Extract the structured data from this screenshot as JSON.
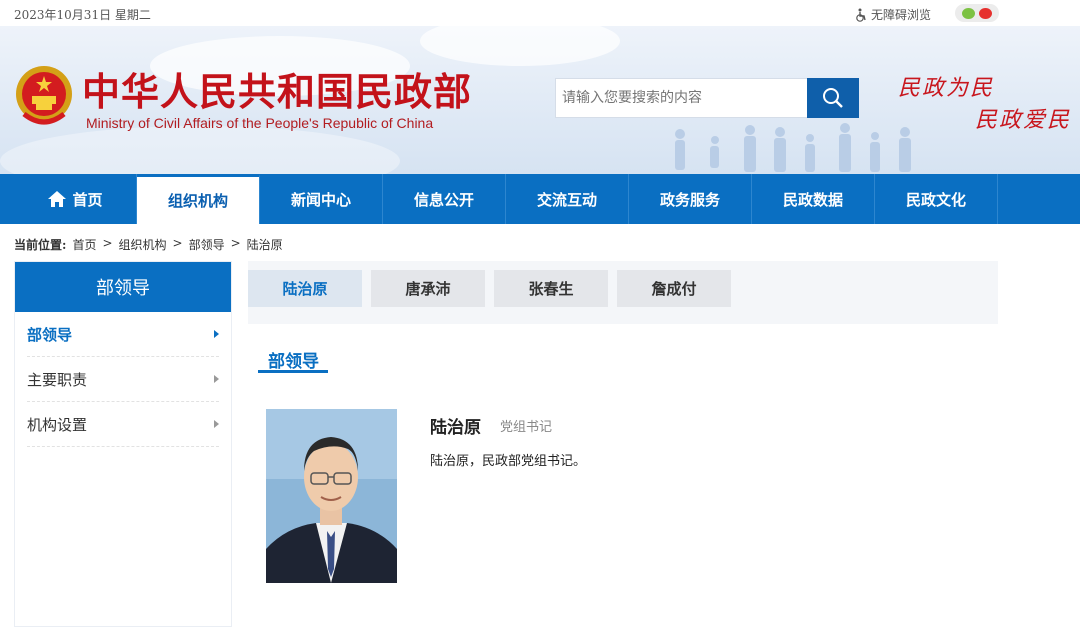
{
  "topbar": {
    "date": "2023年10月31日 星期二",
    "accessibility": "无障碍浏览"
  },
  "header": {
    "title": "中华人民共和国民政部",
    "subtitle": "Ministry of Civil Affairs of the People's Republic of China",
    "search_placeholder": "请输入您要搜索的内容",
    "slogan_1": "民政为民",
    "slogan_2": "民政爱民"
  },
  "nav": [
    "首页",
    "组织机构",
    "新闻中心",
    "信息公开",
    "交流互动",
    "政务服务",
    "民政数据",
    "民政文化"
  ],
  "breadcrumb": {
    "label": "当前位置:",
    "items": [
      "首页",
      ">",
      "组织机构",
      ">",
      "部领导",
      ">",
      "陆治原"
    ]
  },
  "sidebar": {
    "title": "部领导",
    "items": [
      "部领导",
      "主要职责",
      "机构设置"
    ]
  },
  "tabs": [
    "陆治原",
    "唐承沛",
    "张春生",
    "詹成付"
  ],
  "section": {
    "title": "部领导"
  },
  "profile": {
    "name": "陆治原",
    "position": "党组书记",
    "description": "陆治原，民政部党组书记。"
  },
  "colors": {
    "primary": "#0a6fc2",
    "brand_red": "#c3121a"
  }
}
